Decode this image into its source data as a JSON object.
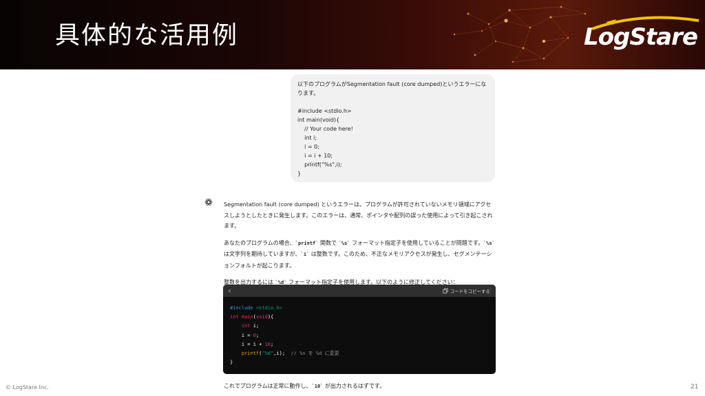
{
  "header": {
    "title": "具体的な活用例",
    "logo_text": "LogStare"
  },
  "user_message": {
    "intro": "以下のプログラムがSegmentation fault (core dumped)というエラーになります。",
    "code_lines": [
      "#include <stdio.h>",
      "int main(void){",
      "    // Your code here!",
      "    int i;",
      "    i = 0;",
      "    i = i + 10;",
      "    printf(\"%s\",i);",
      "}"
    ]
  },
  "answer": {
    "p1": "Segmentation fault (core dumped) というエラーは、プログラムが許可されていないメモリ領域にアクセスしようとしたときに発生します。このエラーは、通常、ポインタや配列の誤った使用によって引き起こされます。",
    "p2_a": "あなたのプログラムの場合、",
    "p2_printf": "`printf`",
    "p2_b": " 関数で ",
    "p2_s": "`%s`",
    "p2_c": " フォーマット指定子を使用していることが問題です。",
    "p2_s2": "`%s`",
    "p2_d": " は文字列を期待していますが、",
    "p2_i": "`i`",
    "p2_e": " は整数です。このため、不正なメモリアクセスが発生し、セグメンテーションフォルトが起こります。",
    "p3_a": "整数を出力するには ",
    "p3_d": "`%d`",
    "p3_b": " フォーマット指定子を使用します。以下のように修正してください：",
    "final_a": "これでプログラムは正常に動作し、",
    "final_10": "`10`",
    "final_b": " が出力されるはずです。"
  },
  "code_block": {
    "language": "c",
    "copy_label": "コードをコピーする",
    "include_kw": "#include",
    "include_hdr": "<stdio.h>",
    "int_kw": "int",
    "main_fn": "main",
    "void_kw": "void",
    "open_brace": "){",
    "decl_int": "int",
    "decl_rest": " i;",
    "assign_a": "i = ",
    "zero": "0",
    "semi": ";",
    "add_a": "i = i + ",
    "ten": "10",
    "printf_fn": "printf",
    "printf_open": "(",
    "fmt": "\"%d\"",
    "printf_rest": ",i);  ",
    "comment": "// %s を %d に変更",
    "close_brace": "}"
  },
  "footer": {
    "copyright": "© LogStare Inc.",
    "page_number": "21"
  },
  "colors": {
    "header_bg": "#1a0605",
    "bubble_bg": "#f1f1f1",
    "code_bg": "#0d0d0d",
    "code_header_bg": "#2f2f2f"
  }
}
